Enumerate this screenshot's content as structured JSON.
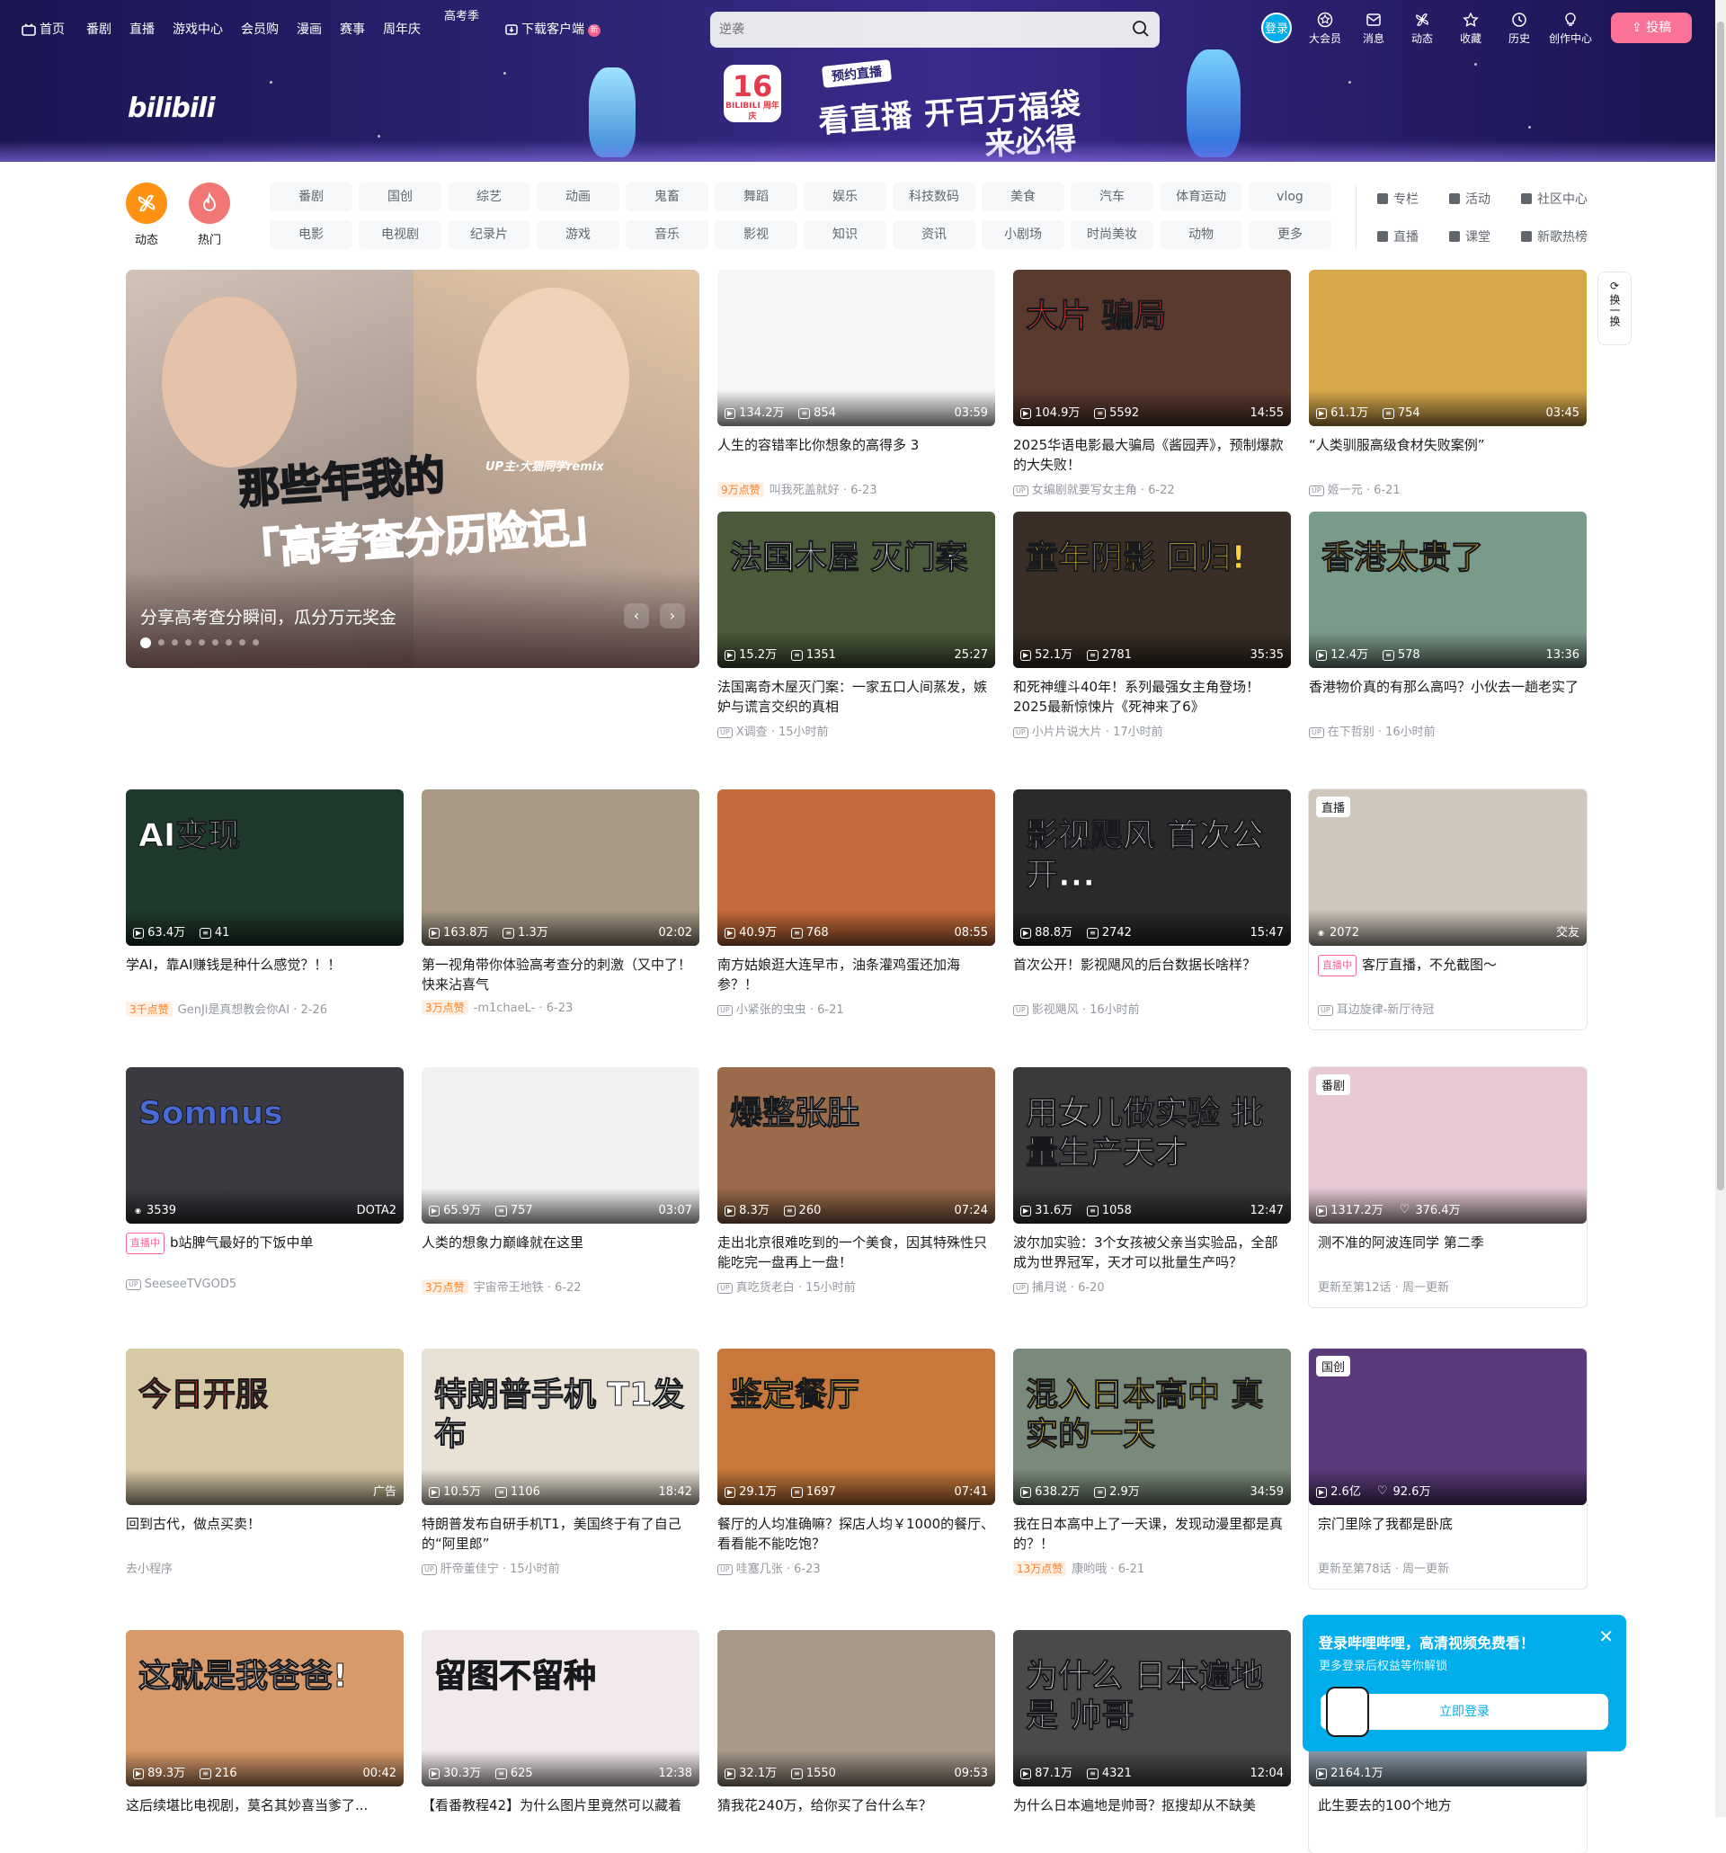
{
  "nav": {
    "left": [
      {
        "label": "首页",
        "icon": "tv-icon"
      },
      {
        "label": "番剧"
      },
      {
        "label": "直播"
      },
      {
        "label": "游戏中心"
      },
      {
        "label": "会员购"
      },
      {
        "label": "漫画"
      },
      {
        "label": "赛事"
      },
      {
        "label": "周年庆"
      }
    ],
    "gaokao": "高考季",
    "download": "下载客户端",
    "download_badge": "新",
    "search_placeholder": "逆袭",
    "login": "登录",
    "right": [
      {
        "label": "大会员",
        "icon": "vip-icon"
      },
      {
        "label": "消息",
        "icon": "message-icon"
      },
      {
        "label": "动态",
        "icon": "dynamic-icon"
      },
      {
        "label": "收藏",
        "icon": "favorite-icon"
      },
      {
        "label": "历史",
        "icon": "history-icon"
      },
      {
        "label": "创作中心",
        "icon": "bulb-icon"
      }
    ],
    "upload": "投稿"
  },
  "banner": {
    "logo": "bilibili",
    "anniv_num": "16",
    "anniv_sub": "BILIBILI 周年庆",
    "tag": "预约直播",
    "line1": "看直播 开百万福袋",
    "line2": "来必得"
  },
  "channels": {
    "big": [
      {
        "label": "动态",
        "color": "#ff9212"
      },
      {
        "label": "热门",
        "color": "#f07775"
      }
    ],
    "row1": [
      "番剧",
      "国创",
      "综艺",
      "动画",
      "鬼畜",
      "舞蹈",
      "娱乐",
      "科技数码",
      "美食",
      "汽车",
      "体育运动",
      "vlog"
    ],
    "row2": [
      "电影",
      "电视剧",
      "纪录片",
      "游戏",
      "音乐",
      "影视",
      "知识",
      "资讯",
      "小剧场",
      "时尚美妆",
      "动物",
      "更多"
    ],
    "side": [
      "专栏",
      "活动",
      "社区中心",
      "直播",
      "课堂",
      "新歌热榜"
    ]
  },
  "hero": {
    "caption": "分享高考查分瞬间，瓜分万元奖金",
    "overlay1": "那些年我的",
    "overlay2": "「高考查分历险记」",
    "overlay_up": "UP主·大猫同学remix",
    "dots": 9
  },
  "refresh": "换一换",
  "cards": [
    {
      "title": "人生的容错率比你想象的高得多 3",
      "views": "134.2万",
      "danmaku": "854",
      "dur": "03:59",
      "hot": "9万点赞",
      "author": "叫我死盖就好",
      "date": "6-23",
      "bg": "#f5f5f5"
    },
    {
      "title": "2025华语电影最大骗局《酱园弄》，预制爆款的大失败！",
      "views": "104.9万",
      "danmaku": "5592",
      "dur": "14:55",
      "up": true,
      "author": "女编剧就要写女主角",
      "date": "6-22",
      "bg": "#5a3a2e",
      "ov": "大片  骗局",
      "ovc": "#ff3b2f"
    },
    {
      "title": "“人类驯服高级食材失败案例”",
      "views": "61.1万",
      "danmaku": "754",
      "dur": "03:45",
      "up": true,
      "author": "姬一元",
      "date": "6-21",
      "bg": "#d6a84a"
    },
    {
      "title": "法国离奇木屋灭门案：一家五口人间蒸发，嫉妒与谎言交织的真相",
      "views": "15.2万",
      "danmaku": "1351",
      "dur": "25:27",
      "up": true,
      "author": "X调查",
      "date": "15小时前",
      "bg": "#4a5a3a",
      "ov": "法国木屋 灭门案",
      "ovc": "#fff"
    },
    {
      "title": "和死神缠斗40年！系列最强女主角登场！2025最新惊悚片《死神来了6》",
      "views": "52.1万",
      "danmaku": "2781",
      "dur": "35:35",
      "up": true,
      "author": "小片片说大片",
      "date": "17小时前",
      "bg": "#3a2e26",
      "ov": "童年阴影 回归!",
      "ovc": "#ffd23a"
    },
    {
      "title": "香港物价真的有那么高吗？小伙去一趟老实了",
      "views": "12.4万",
      "danmaku": "578",
      "dur": "13:36",
      "up": true,
      "author": "在下哲别",
      "date": "16小时前",
      "bg": "#7a9a8a",
      "ov": "香港太贵了",
      "ovc": "#ffd23a"
    },
    {
      "title": "学AI，靠AI赚钱是种什么感觉？！！",
      "views": "63.4万",
      "danmaku": "41",
      "dur": "",
      "hot": "3千点赞",
      "author": "GenJi是真想教会你AI",
      "date": "2-26",
      "bg": "#1f3a2c",
      "ov": "AI变现",
      "ovc": "#fff"
    },
    {
      "title": "第一视角带你体验高考查分的刺激（又中了！快来沾喜气",
      "views": "163.8万",
      "danmaku": "1.3万",
      "dur": "02:02",
      "hot": "3万点赞",
      "author": "-m1chaeL-",
      "date": "6-23",
      "bg": "#a89a86"
    },
    {
      "title": "南方姑娘逛大连早市，油条灌鸡蛋还加海参？！",
      "views": "40.9万",
      "danmaku": "768",
      "dur": "08:55",
      "up": true,
      "author": "小紧张的虫虫",
      "date": "6-21",
      "bg": "#c56a3a"
    },
    {
      "title": "首次公开！影视飓风的后台数据长啥样？",
      "views": "88.8万",
      "danmaku": "2742",
      "dur": "15:47",
      "up": true,
      "author": "影视飓风",
      "date": "16小时前",
      "bg": "#2a2a2a",
      "ov": "影视飓风 首次公开...",
      "ovc": "#fff"
    },
    {
      "title": "客厅直播，不允截图～",
      "views": "2072",
      "danmaku": "",
      "dur": "交友",
      "live": "直播中",
      "livetag": "直播",
      "up": true,
      "author": "耳边旋律-新厅待冠",
      "date": "",
      "bg": "#cfc6bc",
      "boxed": true
    },
    {
      "title": "b站脾气最好的下饭中单",
      "views": "3539",
      "danmaku": "",
      "dur": "DOTA2",
      "live": "直播中",
      "up": true,
      "author": "SeeseeTVGOD5",
      "date": "",
      "bg": "#3a3a40",
      "ov": "Somnus",
      "ovc": "#4a6ad8"
    },
    {
      "title": "人类的想象力巅峰就在这里",
      "views": "65.9万",
      "danmaku": "757",
      "dur": "03:07",
      "hot": "3万点赞",
      "author": "宇宙帝王地铁",
      "date": "6-22",
      "bg": "#f2f2f2"
    },
    {
      "title": "走出北京很难吃到的一个美食，因其特殊性只能吃完一盘再上一盘！",
      "views": "8.3万",
      "danmaku": "260",
      "dur": "07:24",
      "up": true,
      "author": "真吃货老白",
      "date": "15小时前",
      "bg": "#9a6a4a",
      "ov": "爆整张肚",
      "ovc": "#fff"
    },
    {
      "title": "波尔加实验：3个女孩被父亲当实验品，全部成为世界冠军，天才可以批量生产吗？",
      "views": "31.6万",
      "danmaku": "1058",
      "dur": "12:47",
      "up": true,
      "author": "捕月说",
      "date": "6-20",
      "bg": "#3a3a3a",
      "ov": "用女儿做实验 批量生产天才",
      "ovc": "#fff"
    },
    {
      "title": "测不准的阿波连同学 第二季",
      "views": "1317.2万",
      "danmaku": "376.4万",
      "dur": "",
      "livetag": "番剧",
      "author": "更新至第12话",
      "date": "周一更新",
      "bg": "#e7c9d6",
      "boxed": true,
      "heart": true
    },
    {
      "title": "回到古代，做点买卖！",
      "views": "",
      "danmaku": "",
      "dur": "广告",
      "author": "去小程序",
      "date": "",
      "bg": "#d8c9a6",
      "ov": "今日开服",
      "ovc": "#c4432e",
      "ad": true
    },
    {
      "title": "特朗普发布自研手机T1，美国终于有了自己的“阿里郎”",
      "views": "10.5万",
      "danmaku": "1106",
      "dur": "18:42",
      "up": true,
      "author": "肝帝董佳宁",
      "date": "15小时前",
      "bg": "#e9e2d4",
      "ov": "特朗普手机 T1发布",
      "ovc": "#fff"
    },
    {
      "title": "餐厅的人均准确嘛？探店人均￥1000的餐厅、看看能不能吃饱？",
      "views": "29.1万",
      "danmaku": "1697",
      "dur": "07:41",
      "up": true,
      "author": "哇塞几张",
      "date": "6-23",
      "bg": "#c8783a",
      "ov": "鉴定餐厅",
      "ovc": "#ffe23a"
    },
    {
      "title": "我在日本高中上了一天课，发现动漫里都是真的？！",
      "views": "638.2万",
      "danmaku": "2.9万",
      "dur": "34:59",
      "hot": "13万点赞",
      "author": "康哟哦",
      "date": "6-21",
      "bg": "#7a8a7a",
      "ov": "混入日本高中 真实的一天",
      "ovc": "#ffe23a"
    },
    {
      "title": "宗门里除了我都是卧底",
      "views": "2.6亿",
      "danmaku": "92.6万",
      "dur": "",
      "livetag": "国创",
      "author": "更新至第78话",
      "date": "周一更新",
      "bg": "#5a3a7a",
      "boxed": true,
      "heart": true
    },
    {
      "title": "这后续堪比电视剧，莫名其妙喜当爹了...",
      "views": "89.3万",
      "danmaku": "216",
      "dur": "00:42",
      "bg": "#d89a6a",
      "ov": "这就是我爸爸!",
      "ovc": "#fff"
    },
    {
      "title": "【看番教程42】为什么图片里竟然可以藏着",
      "views": "30.3万",
      "danmaku": "625",
      "dur": "12:38",
      "bg": "#f2e9ea",
      "ov": "留图不留种",
      "ovc": "#18191c"
    },
    {
      "title": "猜我花240万，给你买了台什么车？",
      "views": "32.1万",
      "danmaku": "1550",
      "dur": "09:53",
      "bg": "#a8988a"
    },
    {
      "title": "为什么日本遍地是帅哥？抠搜却从不缺美",
      "views": "87.1万",
      "danmaku": "4321",
      "dur": "12:04",
      "bg": "#4a4a4a",
      "ov": "为什么 日本遍地是 帅哥",
      "ovc": "#fff"
    },
    {
      "title": "此生要去的100个地方",
      "views": "2164.1万",
      "danmaku": "",
      "dur": "",
      "bg": "#8a9aa8",
      "boxed": true
    }
  ],
  "popup": {
    "title": "登录哔哩哔哩，高清视频免费看！",
    "sub": "更多登录后权益等你解锁",
    "btn": "立即登录"
  }
}
